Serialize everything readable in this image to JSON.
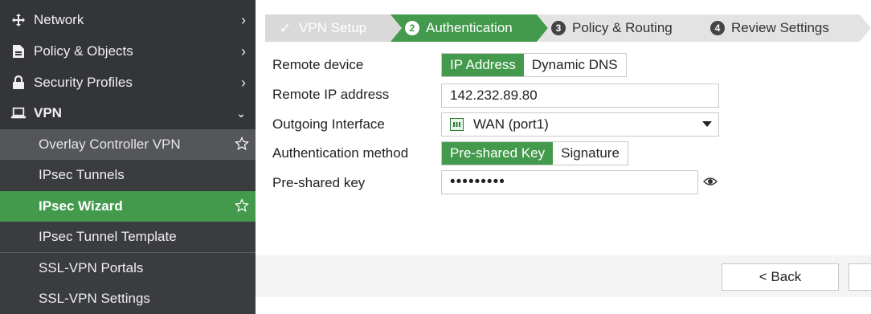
{
  "sidebar": {
    "network": "Network",
    "policy_objects": "Policy & Objects",
    "security_profiles": "Security Profiles",
    "vpn": "VPN",
    "sub_items": {
      "overlay": "Overlay Controller VPN",
      "ipsec_tunnels": "IPsec Tunnels",
      "ipsec_wizard": "IPsec Wizard",
      "ipsec_template": "IPsec Tunnel Template",
      "ssl_portals": "SSL-VPN Portals",
      "ssl_settings": "SSL-VPN Settings"
    }
  },
  "wizard": {
    "steps": [
      {
        "num": "✓",
        "label": "VPN Setup",
        "state": "done"
      },
      {
        "num": "2",
        "label": "Authentication",
        "state": "current"
      },
      {
        "num": "3",
        "label": "Policy & Routing",
        "state": "pending"
      },
      {
        "num": "4",
        "label": "Review Settings",
        "state": "pending"
      }
    ]
  },
  "form": {
    "remote_device": {
      "label": "Remote device",
      "options": [
        "IP Address",
        "Dynamic DNS"
      ],
      "selected": "IP Address"
    },
    "remote_ip": {
      "label": "Remote IP address",
      "value": "142.232.89.80"
    },
    "outgoing_interface": {
      "label": "Outgoing Interface",
      "value": "WAN (port1)"
    },
    "auth_method": {
      "label": "Authentication method",
      "options": [
        "Pre-shared Key",
        "Signature"
      ],
      "selected": "Pre-shared Key"
    },
    "psk": {
      "label": "Pre-shared key",
      "value": "•••••••••"
    }
  },
  "footer": {
    "back_label": "< Back",
    "next_label": ""
  },
  "colors": {
    "accent": "#439a4c",
    "sidebar_bg": "#333538"
  }
}
